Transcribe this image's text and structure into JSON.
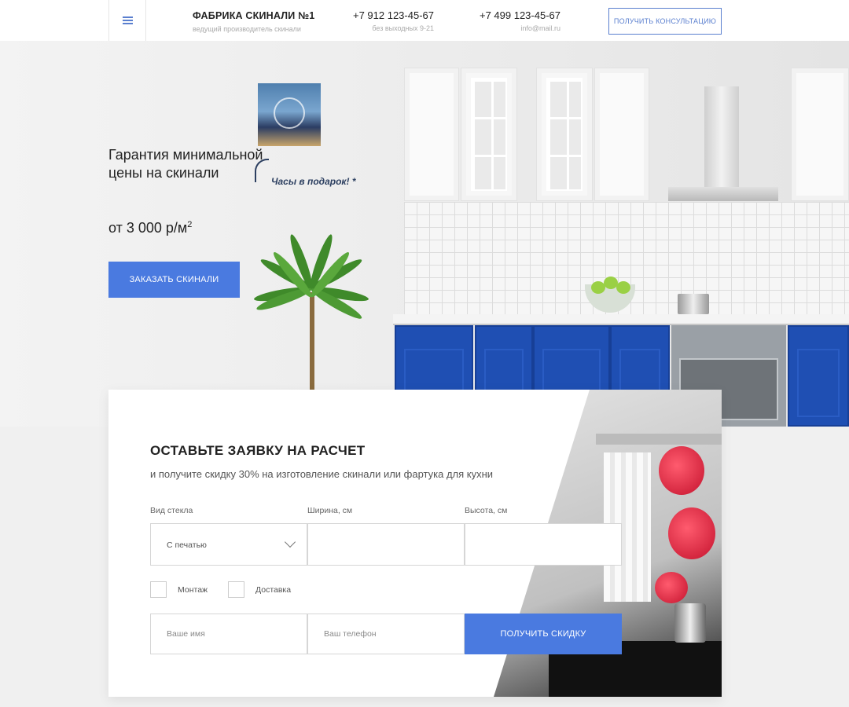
{
  "header": {
    "brand_title": "ФАБРИКА СКИНАЛИ №1",
    "brand_subtitle": "ведущий производитель скинали",
    "phone1": "+7 912 123-45-67",
    "phone1_sub": "без выходных 9-21",
    "phone2": "+7 499 123-45-67",
    "phone2_sub": "info@mail.ru",
    "consult_button": "ПОЛУЧИТЬ КОНСУЛЬТАЦИЮ",
    "menu_icon": "hamburger-menu-icon"
  },
  "hero": {
    "title": "Гарантия минимальной цены на скинали",
    "price": "от 3 000 р/м",
    "price_sup": "2",
    "gift_label": "Часы в подарок! *",
    "order_button": "ЗАКАЗАТЬ СКИНАЛИ"
  },
  "form": {
    "title": "ОСТАВЬТЕ ЗАЯВКУ НА РАСЧЕТ",
    "subtitle": "и получите скидку 30% на изготовление скинали или фартука для кухни",
    "glass_label": "Вид стекла",
    "glass_value": "С печатью",
    "width_label": "Ширина, см",
    "width_value": "",
    "height_label": "Высота, см",
    "height_value": "",
    "option_mount": "Монтаж",
    "option_delivery": "Доставка",
    "name_placeholder": "Ваше имя",
    "phone_placeholder": "Ваш телефон",
    "submit_button": "ПОЛУЧИТЬ СКИДКУ"
  },
  "colors": {
    "accent": "#4a7ae0",
    "outline_accent": "#5a7fcf",
    "cabinet_blue": "#1f4fb3"
  }
}
